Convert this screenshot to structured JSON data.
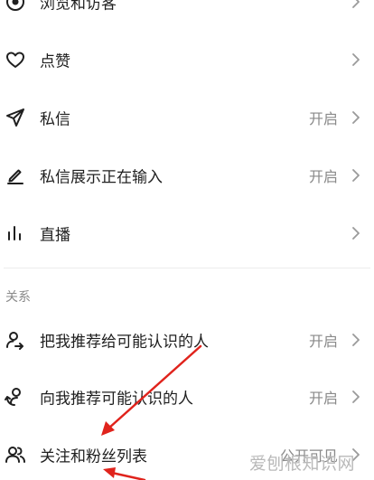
{
  "settings": {
    "items": [
      {
        "label": "浏览和访客",
        "value": "",
        "icon": "eye-circle-icon"
      },
      {
        "label": "点赞",
        "value": "",
        "icon": "heart-icon"
      },
      {
        "label": "私信",
        "value": "开启",
        "icon": "paper-plane-icon"
      },
      {
        "label": "私信展示正在输入",
        "value": "开启",
        "icon": "pencil-icon"
      },
      {
        "label": "直播",
        "value": "",
        "icon": "live-bars-icon"
      }
    ]
  },
  "relations": {
    "section_title": "关系",
    "items": [
      {
        "label": "把我推荐给可能认识的人",
        "value": "开启",
        "icon": "person-share-icon"
      },
      {
        "label": "向我推荐可能认识的人",
        "value": "开启",
        "icon": "person-recommend-icon"
      },
      {
        "label": "关注和粉丝列表",
        "value": "公开可见",
        "icon": "two-persons-icon"
      }
    ]
  },
  "watermark": "爱刨根知识网",
  "colors": {
    "annotation_arrow": "#e0231c",
    "secondary_text": "#8a8a8a"
  }
}
